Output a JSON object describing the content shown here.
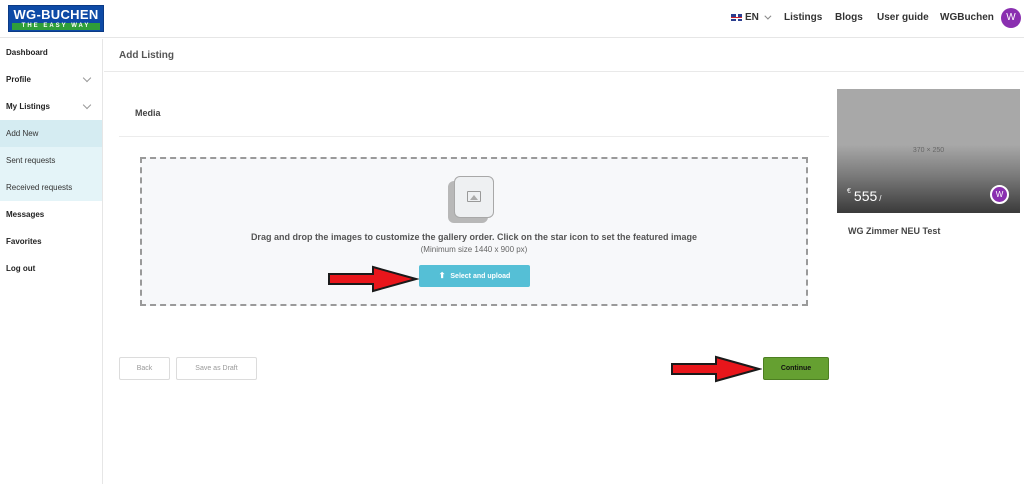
{
  "header": {
    "logo_main": "WG-BUCHEN",
    "logo_sub": "THE EASY WAY",
    "language": "EN",
    "nav": [
      "Listings",
      "Blogs",
      "User guide",
      "WGBuchen"
    ],
    "avatar_initial": "W"
  },
  "sidebar": {
    "items": [
      {
        "label": "Dashboard"
      },
      {
        "label": "Profile"
      },
      {
        "label": "My Listings"
      },
      {
        "label": "Add New"
      },
      {
        "label": "Sent requests"
      },
      {
        "label": "Received requests"
      },
      {
        "label": "Messages"
      },
      {
        "label": "Favorites"
      },
      {
        "label": "Log out"
      }
    ]
  },
  "main": {
    "page_title": "Add Listing",
    "section_title": "Media",
    "dropzone": {
      "instruction": "Drag and drop the images to customize the gallery order. Click on the star icon to set the featured image",
      "min_size": "(Minimum size 1440 x 900 px)",
      "upload_label": "Select and upload"
    },
    "actions": {
      "back": "Back",
      "save_draft": "Save as Draft",
      "continue": "Continue"
    }
  },
  "preview": {
    "placeholder": "370 × 250",
    "currency": "€",
    "price": "555",
    "per": "/",
    "avatar_initial": "W",
    "title": "WG Zimmer NEU Test"
  },
  "colors": {
    "accent_upload": "#55bfd6",
    "accent_continue": "#65a031",
    "brand_blue": "#0d4aa6",
    "avatar_purple": "#8a2fb0",
    "arrow_red": "#e8161b"
  }
}
